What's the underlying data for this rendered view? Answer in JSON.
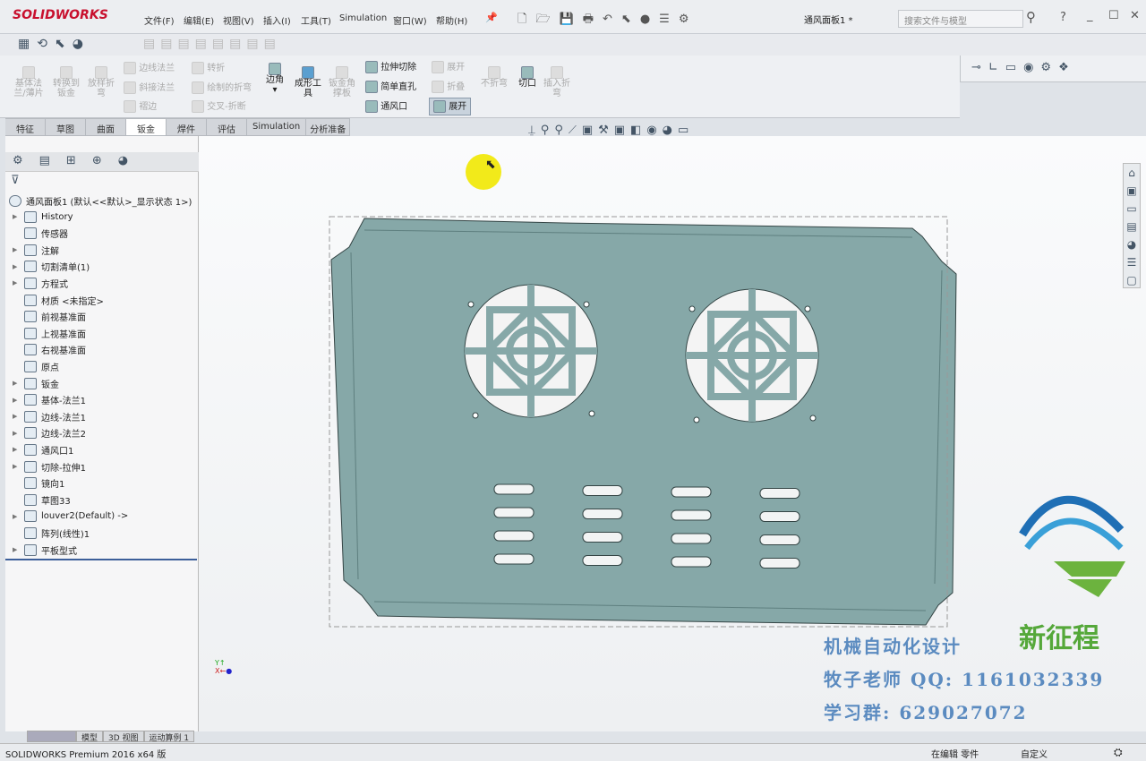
{
  "app": {
    "brand": "SOLIDWORKS",
    "doc_title": "通风面板1 *",
    "search_placeholder": "搜索文件与模型"
  },
  "menu": [
    "文件(F)",
    "编辑(E)",
    "视图(V)",
    "插入(I)",
    "工具(T)",
    "Simulation",
    "窗口(W)",
    "帮助(H)"
  ],
  "ribbon": {
    "col1": [
      "基体法兰/薄片",
      "转换到钣金",
      "放样折弯"
    ],
    "col2": [
      "边线法兰",
      "斜接法兰",
      "褶边"
    ],
    "col3": [
      "转折",
      "绘制的折弯",
      "交叉-折断"
    ],
    "corner": "边角",
    "forming": "成形工具",
    "gusset": "钣金角撑板",
    "col4": [
      "拉伸切除",
      "简单直孔",
      "通风口"
    ],
    "col5": [
      "展开",
      "折叠",
      "展开"
    ],
    "no_bend": "不折弯",
    "rip": "切口",
    "insert_bends": "插入折弯"
  },
  "tabs": [
    "特征",
    "草图",
    "曲面",
    "钣金",
    "焊件",
    "评估",
    "Simulation",
    "分析准备"
  ],
  "active_tab": "钣金",
  "tree": {
    "root": "通风面板1  (默认<<默认>_显示状态 1>)",
    "items": [
      {
        "label": "History",
        "exp": true
      },
      {
        "label": "传感器",
        "exp": false
      },
      {
        "label": "注解",
        "exp": true
      },
      {
        "label": "切割清单(1)",
        "exp": true
      },
      {
        "label": "方程式",
        "exp": true
      },
      {
        "label": "材质 <未指定>",
        "exp": false
      },
      {
        "label": "前视基准面",
        "exp": false
      },
      {
        "label": "上视基准面",
        "exp": false
      },
      {
        "label": "右视基准面",
        "exp": false
      },
      {
        "label": "原点",
        "exp": false
      },
      {
        "label": "钣金",
        "exp": true
      },
      {
        "label": "基体-法兰1",
        "exp": true
      },
      {
        "label": "边线-法兰1",
        "exp": true
      },
      {
        "label": "边线-法兰2",
        "exp": true
      },
      {
        "label": "通风口1",
        "exp": true
      },
      {
        "label": "切除-拉伸1",
        "exp": true
      },
      {
        "label": "镜向1",
        "exp": false
      },
      {
        "label": "草图33",
        "exp": false
      },
      {
        "label": "louver2(Default) ->",
        "exp": true
      },
      {
        "label": "阵列(线性)1",
        "exp": false
      },
      {
        "label": "平板型式",
        "exp": true
      }
    ]
  },
  "bottom_tabs": [
    "模型",
    "3D 视图",
    "运动算例 1"
  ],
  "status": {
    "product": "SOLIDWORKS Premium 2016 x64 版",
    "mode": "在编辑 零件",
    "custom": "自定义"
  },
  "watermark": {
    "line1": "机械自动化设计",
    "line2": "牧子老师 QQ: 1161032339",
    "line3": "学习群: 629027072",
    "logo_text": "新征程"
  },
  "colors": {
    "part": "#86a8a8",
    "accent": "#c8102e"
  }
}
